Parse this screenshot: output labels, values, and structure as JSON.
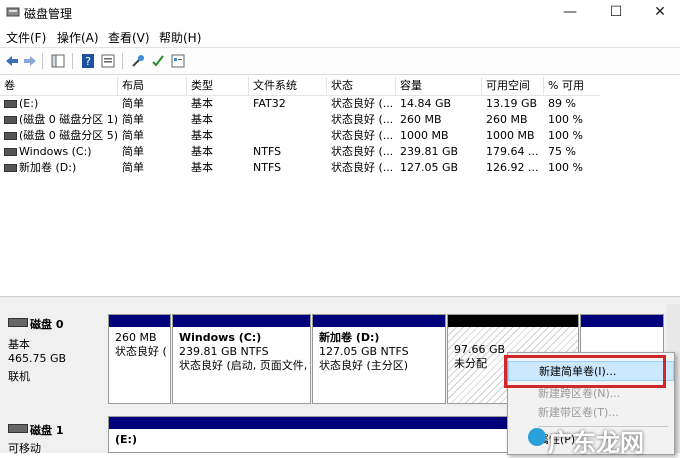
{
  "window": {
    "title": "磁盘管理",
    "minimize": "—",
    "maximize": "☐",
    "close": "✕"
  },
  "menu": [
    "文件(F)",
    "操作(A)",
    "查看(V)",
    "帮助(H)"
  ],
  "columns": [
    "卷",
    "布局",
    "类型",
    "文件系统",
    "状态",
    "容量",
    "可用空间",
    "% 可用"
  ],
  "volumes": [
    [
      "(E:)",
      "简单",
      "基本",
      "FAT32",
      "状态良好 (...",
      "14.84 GB",
      "13.19 GB",
      "89 %"
    ],
    [
      "(磁盘 0 磁盘分区 1)",
      "简单",
      "基本",
      "",
      "状态良好 (...",
      "260 MB",
      "260 MB",
      "100 %"
    ],
    [
      "(磁盘 0 磁盘分区 5)",
      "简单",
      "基本",
      "",
      "状态良好 (...",
      "1000 MB",
      "1000 MB",
      "100 %"
    ],
    [
      "Windows (C:)",
      "简单",
      "基本",
      "NTFS",
      "状态良好 (...",
      "239.81 GB",
      "179.64 ...",
      "75 %"
    ],
    [
      "新加卷 (D:)",
      "简单",
      "基本",
      "NTFS",
      "状态良好 (...",
      "127.05 GB",
      "126.92 ...",
      "100 %"
    ]
  ],
  "disk0": {
    "name": "磁盘 0",
    "type": "基本",
    "size": "465.75 GB",
    "status": "联机",
    "parts": [
      {
        "l1": "",
        "l2": "260 MB",
        "l3": "状态良好 ("
      },
      {
        "l1": "Windows  (C:)",
        "l2": "239.81 GB NTFS",
        "l3": "状态良好 (启动, 页面文件,"
      },
      {
        "l1": "新加卷  (D:)",
        "l2": "127.05 GB NTFS",
        "l3": "状态良好 (主分区)"
      },
      {
        "l1": "",
        "l2": "97.66 GB",
        "l3": "未分配"
      }
    ]
  },
  "disk1": {
    "name": "磁盘 1",
    "type": "可移动",
    "part_label": "(E:)"
  },
  "context_menu": {
    "items": [
      "新建简单卷(I)...",
      "新建跨区卷(N)...",
      "新建带区卷(T)...",
      "属性(P)"
    ]
  },
  "watermark": "广东龙网"
}
